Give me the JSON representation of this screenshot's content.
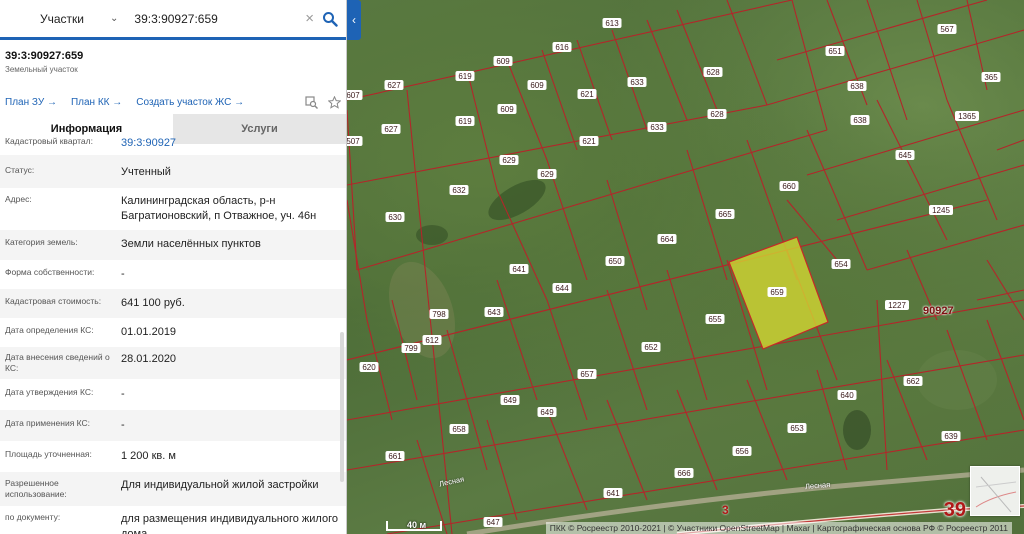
{
  "search": {
    "type": "Участки",
    "value": "39:3:90927:659"
  },
  "parcel": {
    "id": "39:3:90927:659",
    "type": "Земельный участок"
  },
  "links": [
    "План ЗУ →",
    "План КК →",
    "Создать участок ЖС →"
  ],
  "tabs": {
    "info": "Информация",
    "services": "Услуги"
  },
  "rows": [
    {
      "label": "Кадастровый квартал:",
      "value": "39:3:90927"
    },
    {
      "label": "Статус:",
      "value": "Учтенный"
    },
    {
      "label": "Адрес:",
      "value": "Калининградская область, р-н Багратионовский, п Отважное, уч. 46н"
    },
    {
      "label": "Категория земель:",
      "value": "Земли населённых пунктов"
    },
    {
      "label": "Форма собственности:",
      "value": "-"
    },
    {
      "label": "Кадастровая стоимость:",
      "value": "641 100 руб."
    },
    {
      "label": "Дата определения КС:",
      "value": "01.01.2019"
    },
    {
      "label": "Дата внесения сведений о КС:",
      "value": "28.01.2020"
    },
    {
      "label": "Дата утверждения КС:",
      "value": "-"
    },
    {
      "label": "Дата применения КС:",
      "value": "-"
    },
    {
      "label": "Площадь уточненная:",
      "value": "1 200 кв. м"
    },
    {
      "label": "Разрешенное использование:",
      "value": "Для индивидуальной жилой застройки"
    },
    {
      "label": "по документу:",
      "value": "для размещения индивидуального жилого дома"
    }
  ],
  "map": {
    "parcel_labels": [
      "567",
      "613",
      "616",
      "651",
      "609",
      "609",
      "619",
      "627",
      "628",
      "633",
      "365",
      "638",
      "607",
      "627",
      "619",
      "621",
      "621",
      "609",
      "633",
      "628",
      "1365",
      "638",
      "645",
      "507",
      "629",
      "629",
      "660",
      "632",
      "1245",
      "630",
      "665",
      "664",
      "654",
      "650",
      "644",
      "641",
      "643",
      "798",
      "612",
      "799",
      "659",
      "655",
      "1227",
      "652",
      "620",
      "657",
      "649",
      "649",
      "658",
      "661",
      "640",
      "662",
      "653",
      "639",
      "656",
      "666",
      "641",
      "647"
    ],
    "selected_parcel": "659",
    "quarter_label": "90927",
    "road_number": "39",
    "road_number_small": "3",
    "road_names": [
      "Лесная",
      "Лесная"
    ],
    "scale_label": "40 м",
    "attribution": "ПКК © Росреестр 2010-2021 | © Участники OpenStreetMap | Maxar | Картографическая основа РФ © Росреестр 2011"
  },
  "colors": {
    "accent": "#1e63b5",
    "parcel_border": "#b3262a",
    "selected_fill": "#d6d832"
  }
}
